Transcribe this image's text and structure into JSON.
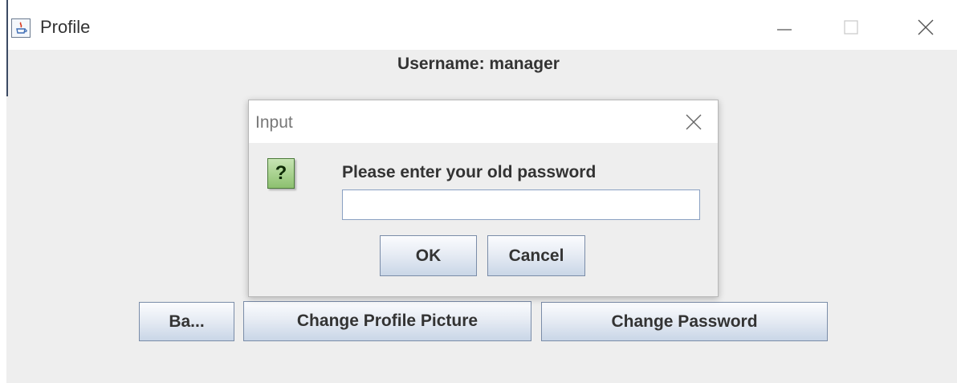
{
  "window": {
    "title": "Profile",
    "controls": {
      "minimize_icon": "minimize-icon",
      "maximize_icon": "maximize-icon",
      "close_icon": "close-icon"
    }
  },
  "profile": {
    "username_text": "Username: manager",
    "buttons": {
      "back": "Ba...",
      "change_picture": "Change Profile Picture",
      "change_password": "Change Password"
    }
  },
  "dialog": {
    "title": "Input",
    "icon": "question-icon",
    "icon_glyph": "?",
    "prompt": "Please enter your old password",
    "input_value": "",
    "ok_label": "OK",
    "cancel_label": "Cancel"
  },
  "colors": {
    "panel": "#eeeeee",
    "button_border": "#7a8ca8",
    "question_icon": "#8dc06f"
  }
}
